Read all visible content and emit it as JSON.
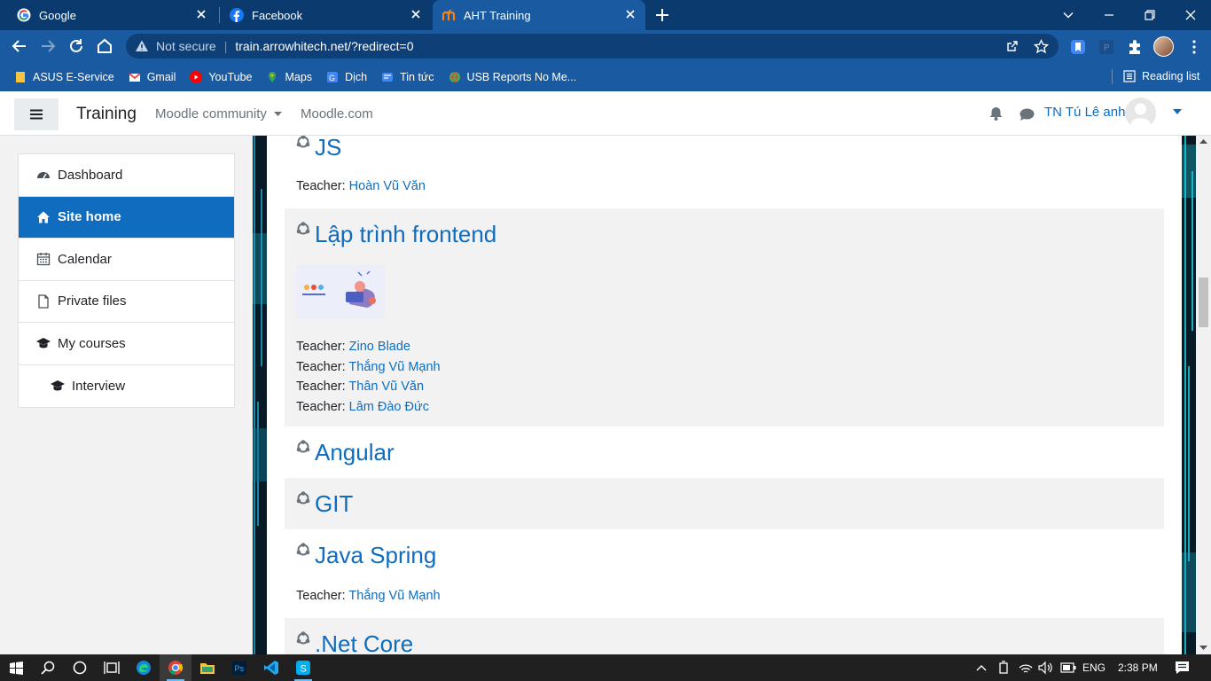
{
  "browser": {
    "tabs": [
      {
        "title": "Google",
        "icon": "google-icon"
      },
      {
        "title": "Facebook",
        "icon": "facebook-icon"
      },
      {
        "title": "AHT Training",
        "icon": "moodle-icon",
        "active": true
      }
    ],
    "security_label": "Not secure",
    "url": "train.arrowhitech.net/?redirect=0",
    "bookmarks": [
      {
        "label": "ASUS E-Service",
        "icon": "folder-icon"
      },
      {
        "label": "Gmail",
        "icon": "gmail-icon"
      },
      {
        "label": "YouTube",
        "icon": "youtube-icon"
      },
      {
        "label": "Maps",
        "icon": "maps-icon"
      },
      {
        "label": "Dịch",
        "icon": "translate-icon"
      },
      {
        "label": "Tin tức",
        "icon": "news-icon"
      },
      {
        "label": "USB Reports No Me...",
        "icon": "globe-icon"
      }
    ],
    "reading_list": "Reading list"
  },
  "navbar": {
    "site_name": "Training",
    "menu": [
      "Moodle community",
      "Moodle.com"
    ],
    "user_name": "TN Tú Lê anh"
  },
  "drawer": [
    {
      "label": "Dashboard",
      "icon": "dashboard-icon"
    },
    {
      "label": "Site home",
      "icon": "home-icon",
      "active": true
    },
    {
      "label": "Calendar",
      "icon": "calendar-icon"
    },
    {
      "label": "Private files",
      "icon": "file-icon"
    },
    {
      "label": "My courses",
      "icon": "graduation-cap-icon"
    },
    {
      "label": "Interview",
      "icon": "graduation-cap-icon"
    }
  ],
  "teacher_label": "Teacher:",
  "courses": [
    {
      "title": "JS",
      "teachers": [
        "Hoàn Vũ Văn"
      ]
    },
    {
      "title": "Lập trình frontend",
      "teachers": [
        "Zino Blade",
        "Thắng Vũ Mạnh",
        "Thân Vũ Văn",
        "Lâm Đào Đức"
      ]
    },
    {
      "title": "Angular",
      "teachers": []
    },
    {
      "title": "GIT",
      "teachers": []
    },
    {
      "title": "Java Spring",
      "teachers": [
        "Thắng Vũ Mạnh"
      ]
    },
    {
      "title": ".Net Core",
      "teachers": []
    }
  ],
  "taskbar": {
    "language": "ENG",
    "time": "2:38 PM"
  },
  "colors": {
    "chrome_tabbar": "#0b3a6e",
    "chrome_toolbar": "#1a5aa0",
    "moodle_primary": "#0f6cbf",
    "drawer_bg": "#f2f2f2",
    "taskbar": "#202020"
  }
}
